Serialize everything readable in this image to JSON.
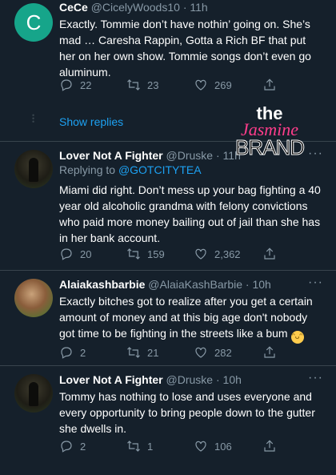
{
  "tweets": [
    {
      "name": "CeCe",
      "handle": "@CicelyWoods10",
      "time": "· 11h",
      "avatar_letter": "C",
      "text": "Exactly. Tommie don’t have nothin’ going on.  She’s mad … Caresha Rappin, Gotta a Rich BF that put her on her own show. Tommie songs don’t even go aluminum.",
      "replies": "22",
      "retweets": "23",
      "likes": "269"
    },
    {
      "name": "Lover Not A Fighter",
      "handle": "@Druske",
      "time": "· 11h",
      "reply_prefix": "Replying to",
      "reply_mention": "@GOTCITYTEA",
      "text": "Miami did right. Don’t mess up your bag fighting a 40 year old alcoholic grandma with felony convictions who paid more money bailing out of jail than she has in her bank account.",
      "replies": "20",
      "retweets": "159",
      "likes": "2,362"
    },
    {
      "name": "Alaiakashbarbie",
      "handle": "@AlaiaKashBarbie",
      "time": "· 10h",
      "text": "Exactly bitches got to realize after you get a certain amount of money and at this big age don't nobody got time to be fighting in the  streets like a bum",
      "replies": "2",
      "retweets": "21",
      "likes": "282"
    },
    {
      "name": "Lover Not A Fighter",
      "handle": "@Druske",
      "time": "· 10h",
      "text": "Tommy has nothing to lose and uses everyone and every opportunity to bring people down to the gutter she dwells in.",
      "replies": "2",
      "retweets": "1",
      "likes": "106"
    }
  ],
  "show_replies": "Show replies",
  "watermark": {
    "line1": "the",
    "line2": "Jasmine",
    "line3": "BRAND"
  },
  "icons": [
    "reply-icon",
    "retweet-icon",
    "like-icon",
    "share-icon",
    "more-icon",
    "laughing-emoji-icon"
  ],
  "colors": {
    "background": "#15202b",
    "link": "#1da1f2",
    "muted": "#8899a6",
    "brand_pink": "#ff3d8b"
  }
}
